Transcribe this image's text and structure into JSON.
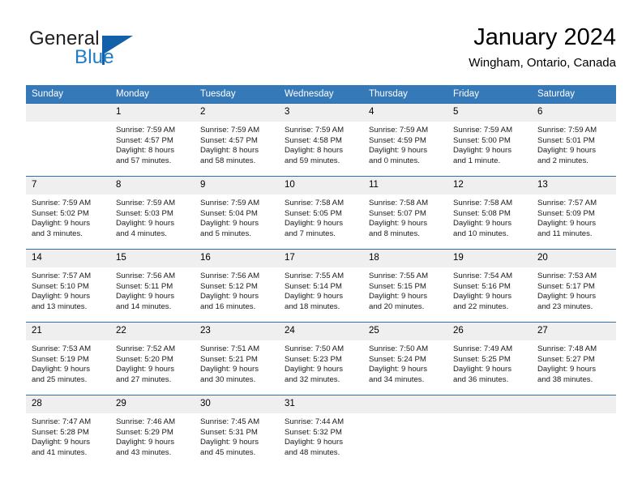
{
  "brand": {
    "name_part1": "General",
    "name_part2": "Blue",
    "logo_icon": "triangle-flag-icon"
  },
  "header": {
    "title": "January 2024",
    "location": "Wingham, Ontario, Canada"
  },
  "calendar": {
    "weekday_headers": [
      "Sunday",
      "Monday",
      "Tuesday",
      "Wednesday",
      "Thursday",
      "Friday",
      "Saturday"
    ],
    "accent_color": "#3679b9",
    "daynum_band_color": "#efefef",
    "weeks": [
      [
        {
          "day": "",
          "lines": []
        },
        {
          "day": "1",
          "lines": [
            "Sunrise: 7:59 AM",
            "Sunset: 4:57 PM",
            "Daylight: 8 hours",
            "and 57 minutes."
          ]
        },
        {
          "day": "2",
          "lines": [
            "Sunrise: 7:59 AM",
            "Sunset: 4:57 PM",
            "Daylight: 8 hours",
            "and 58 minutes."
          ]
        },
        {
          "day": "3",
          "lines": [
            "Sunrise: 7:59 AM",
            "Sunset: 4:58 PM",
            "Daylight: 8 hours",
            "and 59 minutes."
          ]
        },
        {
          "day": "4",
          "lines": [
            "Sunrise: 7:59 AM",
            "Sunset: 4:59 PM",
            "Daylight: 9 hours",
            "and 0 minutes."
          ]
        },
        {
          "day": "5",
          "lines": [
            "Sunrise: 7:59 AM",
            "Sunset: 5:00 PM",
            "Daylight: 9 hours",
            "and 1 minute."
          ]
        },
        {
          "day": "6",
          "lines": [
            "Sunrise: 7:59 AM",
            "Sunset: 5:01 PM",
            "Daylight: 9 hours",
            "and 2 minutes."
          ]
        }
      ],
      [
        {
          "day": "7",
          "lines": [
            "Sunrise: 7:59 AM",
            "Sunset: 5:02 PM",
            "Daylight: 9 hours",
            "and 3 minutes."
          ]
        },
        {
          "day": "8",
          "lines": [
            "Sunrise: 7:59 AM",
            "Sunset: 5:03 PM",
            "Daylight: 9 hours",
            "and 4 minutes."
          ]
        },
        {
          "day": "9",
          "lines": [
            "Sunrise: 7:59 AM",
            "Sunset: 5:04 PM",
            "Daylight: 9 hours",
            "and 5 minutes."
          ]
        },
        {
          "day": "10",
          "lines": [
            "Sunrise: 7:58 AM",
            "Sunset: 5:05 PM",
            "Daylight: 9 hours",
            "and 7 minutes."
          ]
        },
        {
          "day": "11",
          "lines": [
            "Sunrise: 7:58 AM",
            "Sunset: 5:07 PM",
            "Daylight: 9 hours",
            "and 8 minutes."
          ]
        },
        {
          "day": "12",
          "lines": [
            "Sunrise: 7:58 AM",
            "Sunset: 5:08 PM",
            "Daylight: 9 hours",
            "and 10 minutes."
          ]
        },
        {
          "day": "13",
          "lines": [
            "Sunrise: 7:57 AM",
            "Sunset: 5:09 PM",
            "Daylight: 9 hours",
            "and 11 minutes."
          ]
        }
      ],
      [
        {
          "day": "14",
          "lines": [
            "Sunrise: 7:57 AM",
            "Sunset: 5:10 PM",
            "Daylight: 9 hours",
            "and 13 minutes."
          ]
        },
        {
          "day": "15",
          "lines": [
            "Sunrise: 7:56 AM",
            "Sunset: 5:11 PM",
            "Daylight: 9 hours",
            "and 14 minutes."
          ]
        },
        {
          "day": "16",
          "lines": [
            "Sunrise: 7:56 AM",
            "Sunset: 5:12 PM",
            "Daylight: 9 hours",
            "and 16 minutes."
          ]
        },
        {
          "day": "17",
          "lines": [
            "Sunrise: 7:55 AM",
            "Sunset: 5:14 PM",
            "Daylight: 9 hours",
            "and 18 minutes."
          ]
        },
        {
          "day": "18",
          "lines": [
            "Sunrise: 7:55 AM",
            "Sunset: 5:15 PM",
            "Daylight: 9 hours",
            "and 20 minutes."
          ]
        },
        {
          "day": "19",
          "lines": [
            "Sunrise: 7:54 AM",
            "Sunset: 5:16 PM",
            "Daylight: 9 hours",
            "and 22 minutes."
          ]
        },
        {
          "day": "20",
          "lines": [
            "Sunrise: 7:53 AM",
            "Sunset: 5:17 PM",
            "Daylight: 9 hours",
            "and 23 minutes."
          ]
        }
      ],
      [
        {
          "day": "21",
          "lines": [
            "Sunrise: 7:53 AM",
            "Sunset: 5:19 PM",
            "Daylight: 9 hours",
            "and 25 minutes."
          ]
        },
        {
          "day": "22",
          "lines": [
            "Sunrise: 7:52 AM",
            "Sunset: 5:20 PM",
            "Daylight: 9 hours",
            "and 27 minutes."
          ]
        },
        {
          "day": "23",
          "lines": [
            "Sunrise: 7:51 AM",
            "Sunset: 5:21 PM",
            "Daylight: 9 hours",
            "and 30 minutes."
          ]
        },
        {
          "day": "24",
          "lines": [
            "Sunrise: 7:50 AM",
            "Sunset: 5:23 PM",
            "Daylight: 9 hours",
            "and 32 minutes."
          ]
        },
        {
          "day": "25",
          "lines": [
            "Sunrise: 7:50 AM",
            "Sunset: 5:24 PM",
            "Daylight: 9 hours",
            "and 34 minutes."
          ]
        },
        {
          "day": "26",
          "lines": [
            "Sunrise: 7:49 AM",
            "Sunset: 5:25 PM",
            "Daylight: 9 hours",
            "and 36 minutes."
          ]
        },
        {
          "day": "27",
          "lines": [
            "Sunrise: 7:48 AM",
            "Sunset: 5:27 PM",
            "Daylight: 9 hours",
            "and 38 minutes."
          ]
        }
      ],
      [
        {
          "day": "28",
          "lines": [
            "Sunrise: 7:47 AM",
            "Sunset: 5:28 PM",
            "Daylight: 9 hours",
            "and 41 minutes."
          ]
        },
        {
          "day": "29",
          "lines": [
            "Sunrise: 7:46 AM",
            "Sunset: 5:29 PM",
            "Daylight: 9 hours",
            "and 43 minutes."
          ]
        },
        {
          "day": "30",
          "lines": [
            "Sunrise: 7:45 AM",
            "Sunset: 5:31 PM",
            "Daylight: 9 hours",
            "and 45 minutes."
          ]
        },
        {
          "day": "31",
          "lines": [
            "Sunrise: 7:44 AM",
            "Sunset: 5:32 PM",
            "Daylight: 9 hours",
            "and 48 minutes."
          ]
        },
        {
          "day": "",
          "lines": []
        },
        {
          "day": "",
          "lines": []
        },
        {
          "day": "",
          "lines": []
        }
      ]
    ]
  }
}
